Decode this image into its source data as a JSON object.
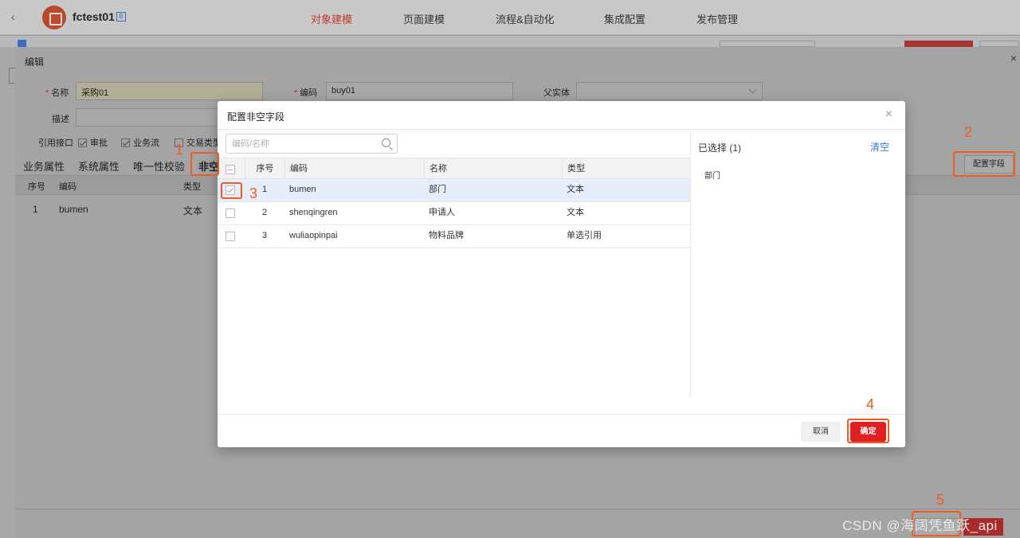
{
  "topbar": {
    "back_icon": "chevron-left-icon",
    "app_name": "fctest01",
    "app_badge": "B",
    "nav": [
      "对象建模",
      "页面建模",
      "流程&自动化",
      "集成配置",
      "发布管理"
    ],
    "accent": "#c0392b"
  },
  "edit": {
    "title": "编辑",
    "close": "×",
    "name_label": "名称",
    "name_value": "采购01",
    "code_label": "编码",
    "code_value": "buy01",
    "parent_label": "父实体",
    "desc_label": "描述",
    "ref_label": "引用接口",
    "ref_options": [
      "审批",
      "业务流",
      "交易类型"
    ],
    "tabs": [
      "业务属性",
      "系统属性",
      "唯一性校验",
      "非空"
    ],
    "table_headers": [
      "序号",
      "编码",
      "类型"
    ],
    "table_rows": [
      [
        "1",
        "bumen",
        "文本"
      ]
    ],
    "config_button": "配置字段"
  },
  "modal": {
    "title": "配置非空字段",
    "close": "×",
    "search_placeholder": "编码/名称",
    "headers": [
      "序号",
      "编码",
      "名称",
      "类型"
    ],
    "rows": [
      {
        "no": "1",
        "code": "bumen",
        "name": "部门",
        "type": "文本",
        "checked": true
      },
      {
        "no": "2",
        "code": "shenqingren",
        "name": "申请人",
        "type": "文本",
        "checked": false
      },
      {
        "no": "3",
        "code": "wuliaopinpai",
        "name": "物料品牌",
        "type": "单选引用",
        "checked": false
      }
    ],
    "selected_title": "已选择 (1)",
    "clear_label": "清空",
    "selected_items": [
      "部门"
    ],
    "cancel_label": "取消",
    "ok_label": "确定",
    "ok_color": "#e02020"
  },
  "annotations": [
    "1",
    "2",
    "3",
    "4",
    "5"
  ],
  "annotation_color": "#f05a23",
  "watermark": "CSDN @海阔凭鱼跃_api"
}
